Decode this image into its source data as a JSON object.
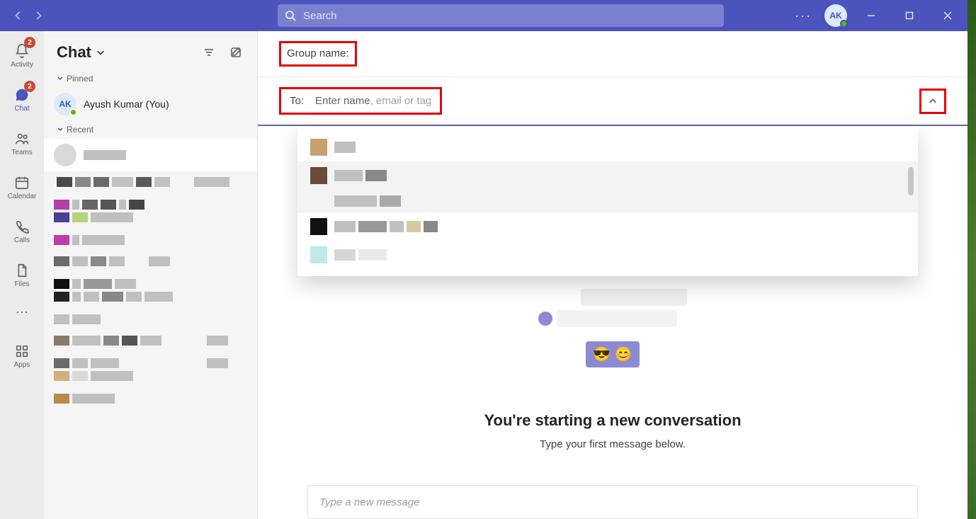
{
  "titlebar": {
    "search_placeholder": "Search",
    "avatar_initials": "AK",
    "more": "···"
  },
  "rail": {
    "activity": {
      "label": "Activity",
      "badge": "2"
    },
    "chat": {
      "label": "Chat",
      "badge": "2"
    },
    "teams": {
      "label": "Teams"
    },
    "calendar": {
      "label": "Calendar"
    },
    "calls": {
      "label": "Calls"
    },
    "files": {
      "label": "Files"
    },
    "apps": {
      "label": "Apps"
    }
  },
  "chatlist": {
    "title": "Chat",
    "pinned": "Pinned",
    "recent": "Recent",
    "you": "Ayush Kumar (You)",
    "you_initials": "AK"
  },
  "compose_header": {
    "group_label": "Group name:",
    "to_label": "To:",
    "to_placeholder_prefix": "Enter name",
    "to_placeholder_suffix": ", email or tag"
  },
  "center": {
    "title": "You're starting a new conversation",
    "subtitle": "Type your first message below.",
    "emoji1": "😎",
    "emoji2": "😊",
    "compose_placeholder": "Type a new message"
  }
}
